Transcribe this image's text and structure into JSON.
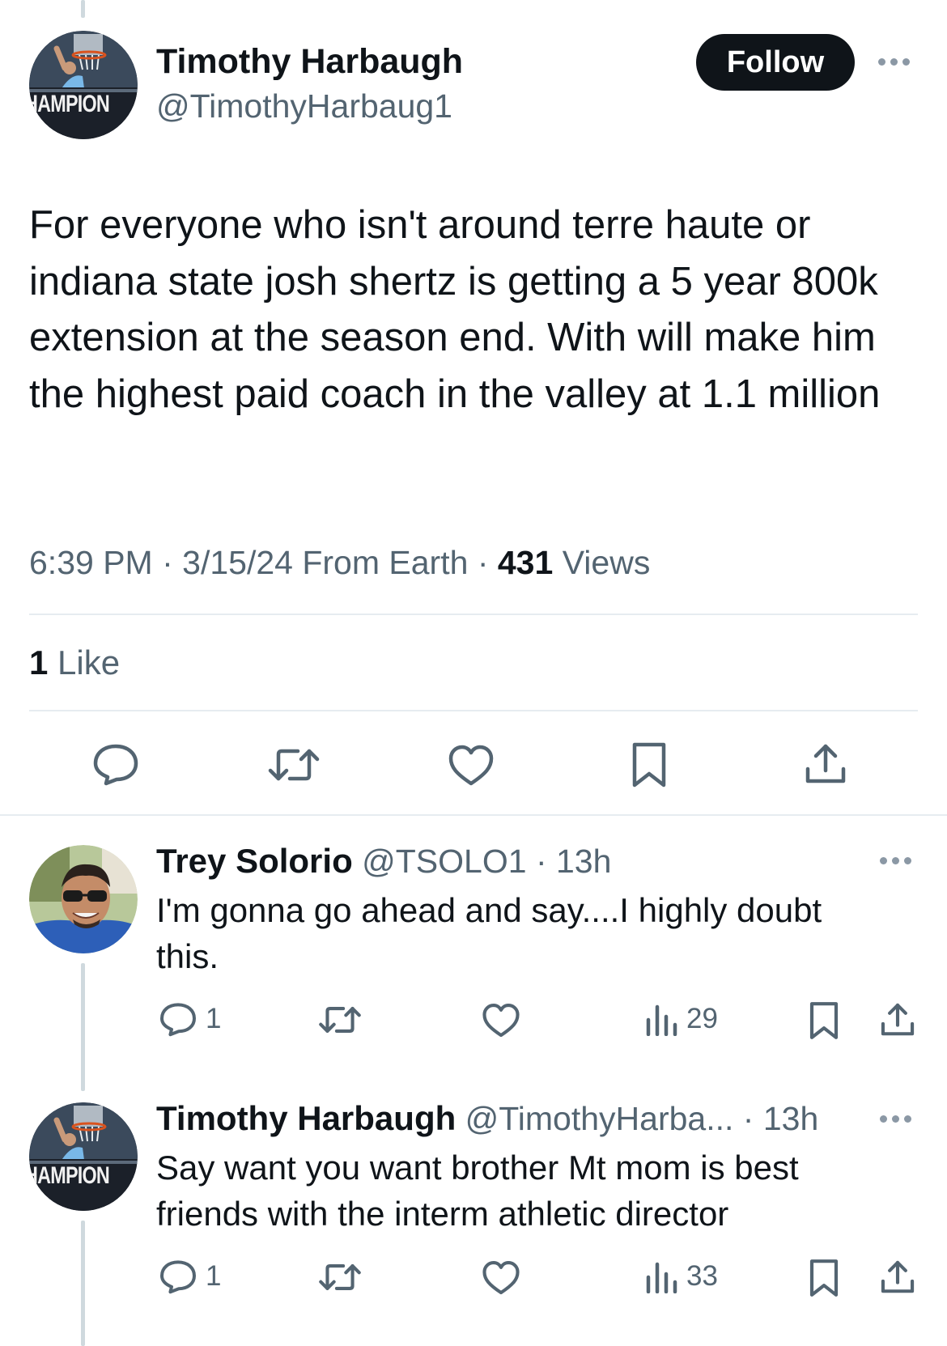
{
  "main_tweet": {
    "author_name": "Timothy Harbaugh",
    "author_handle": "@TimothyHarbaug1",
    "avatar_text": "HAMPION",
    "follow_label": "Follow",
    "text": "For everyone who isn't around terre haute or indiana state josh shertz is getting a 5 year 800k extension at the season end. With will make him the highest paid coach in the valley at 1.1 million",
    "time": "6:39 PM",
    "date": "3/15/24",
    "source": "From Earth",
    "views_count": "431",
    "views_label": "Views",
    "likes_count": "1",
    "likes_label": "Like",
    "actions": [
      "reply-icon",
      "retweet-icon",
      "like-icon",
      "bookmark-icon",
      "share-icon"
    ]
  },
  "replies": [
    {
      "author_name": "Trey Solorio",
      "author_handle": "@TSOLO1",
      "time": "13h",
      "text": "I'm gonna go ahead and say....I highly doubt this.",
      "reply_count": "1",
      "views": "29"
    },
    {
      "author_name": "Timothy Harbaugh",
      "author_handle": "@TimothyHarba...",
      "time": "13h",
      "text": "Say want you want brother Mt mom is best friends with the interm athletic director",
      "reply_count": "1",
      "views": "33",
      "avatar_text": "HAMPION"
    }
  ],
  "colors": {
    "text": "#0f1419",
    "muted": "#536471",
    "divider": "#e6ecf0",
    "thread": "#cfd9de"
  }
}
